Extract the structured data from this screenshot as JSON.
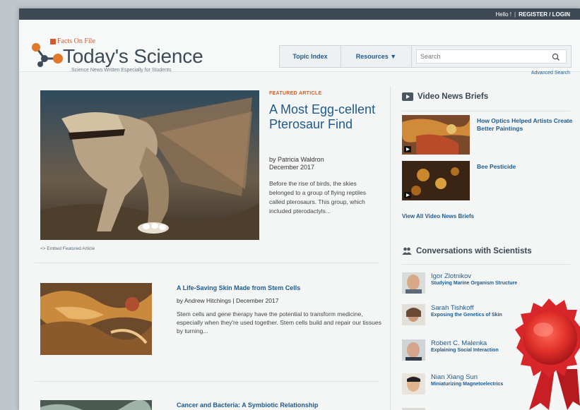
{
  "topbar": {
    "greeting": "Hello !",
    "separator": "|",
    "register_login": "REGISTER / LOGIN"
  },
  "header": {
    "publisher": "Facts On File",
    "brand": "Today's Science",
    "tagline": "Science News Written Especially for Students",
    "nav": {
      "topic_index": "Topic Index",
      "resources": "Resources ▼"
    },
    "search": {
      "placeholder": "Search",
      "advanced": "Advanced Search"
    }
  },
  "featured": {
    "label": "FEATURED ARTICLE",
    "title": "A Most Egg-cellent Pterosaur Find",
    "author": "by Patricia Waldron",
    "date": "December 2017",
    "excerpt": "Before the rise of birds, the skies belonged to a group of flying reptiles called pterosaurs. This group, which included pterodactyls...",
    "embed": "<> Embed Featured Article"
  },
  "articles": [
    {
      "title": "A Life-Saving Skin Made from Stem Cells",
      "byline": "by Andrew Hitchings | December 2017",
      "excerpt": "Stem cells and gene therapy have the potential to transform medicine, especially when they're used together. Stem cells build and repair our tissues by turning..."
    },
    {
      "title": "Cancer and Bacteria: A Symbiotic Relationship"
    }
  ],
  "sidebar": {
    "video_heading": "Video News Briefs",
    "videos": [
      {
        "title": "How Optics Helped Artists Create Better Paintings"
      },
      {
        "title": "Bee Pesticide"
      }
    ],
    "view_all": "View All Video News Briefs",
    "conv_heading": "Conversations with Scientists",
    "scientists": [
      {
        "name": "Igor Zlotnikov",
        "topic": "Studying Marine Organism Structure"
      },
      {
        "name": "Sarah Tishkoff",
        "topic": "Exposing the Genetics of Skin"
      },
      {
        "name": "Robert C. Malenka",
        "topic": "Explaining Social Interaction"
      },
      {
        "name": "Nian Xiang Sun",
        "topic": "Miniaturizing Magnetoelectrics"
      }
    ]
  },
  "colors": {
    "link": "#1d5a8e",
    "accent": "#e05a1e",
    "topbar": "#3d4a55",
    "ribbon": "#d8262a"
  }
}
